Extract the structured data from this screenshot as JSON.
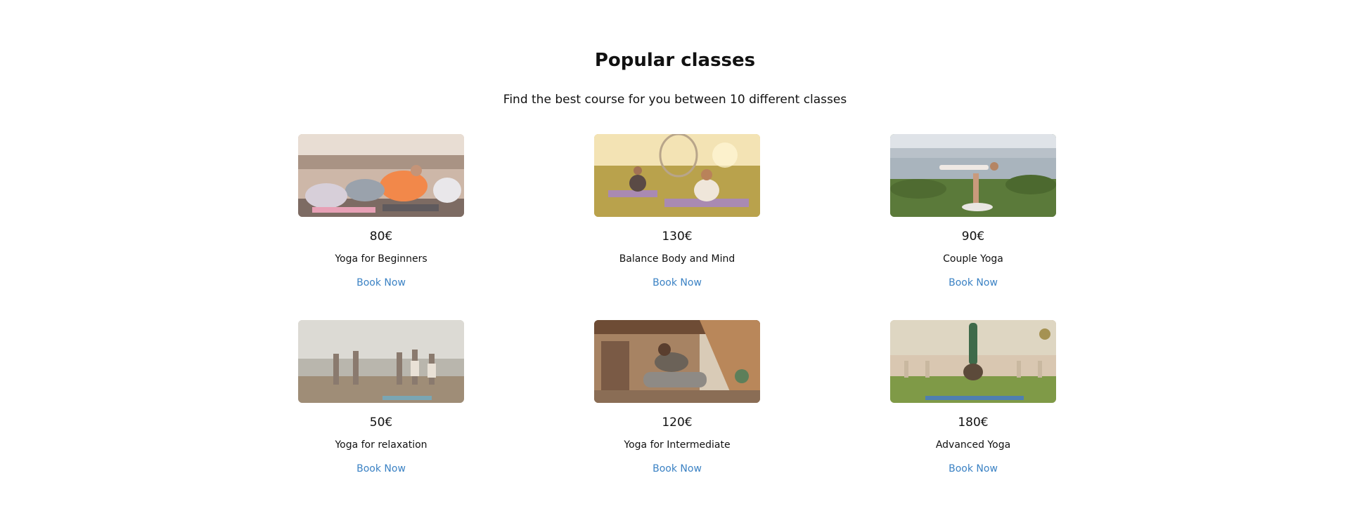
{
  "section": {
    "title": "Popular classes",
    "subtitle": "Find the best course for you between 10 different classes"
  },
  "colors": {
    "link": "#3b82c4",
    "text": "#111111",
    "background": "#ffffff"
  },
  "classes": [
    {
      "price": "80€",
      "name": "Yoga for Beginners",
      "cta": "Book Now",
      "image": "group-yoga-stretch-photo"
    },
    {
      "price": "130€",
      "name": "Balance Body and Mind",
      "cta": "Book Now",
      "image": "outdoor-meditation-photo"
    },
    {
      "price": "90€",
      "name": "Couple Yoga",
      "cta": "Book Now",
      "image": "acro-yoga-lake-photo"
    },
    {
      "price": "50€",
      "name": "Yoga for relaxation",
      "cta": "Book Now",
      "image": "beach-tree-pose-photo"
    },
    {
      "price": "120€",
      "name": "Yoga for Intermediate",
      "cta": "Book Now",
      "image": "studio-pigeon-pose-photo"
    },
    {
      "price": "180€",
      "name": "Advanced Yoga",
      "cta": "Book Now",
      "image": "headstand-garden-photo"
    }
  ]
}
